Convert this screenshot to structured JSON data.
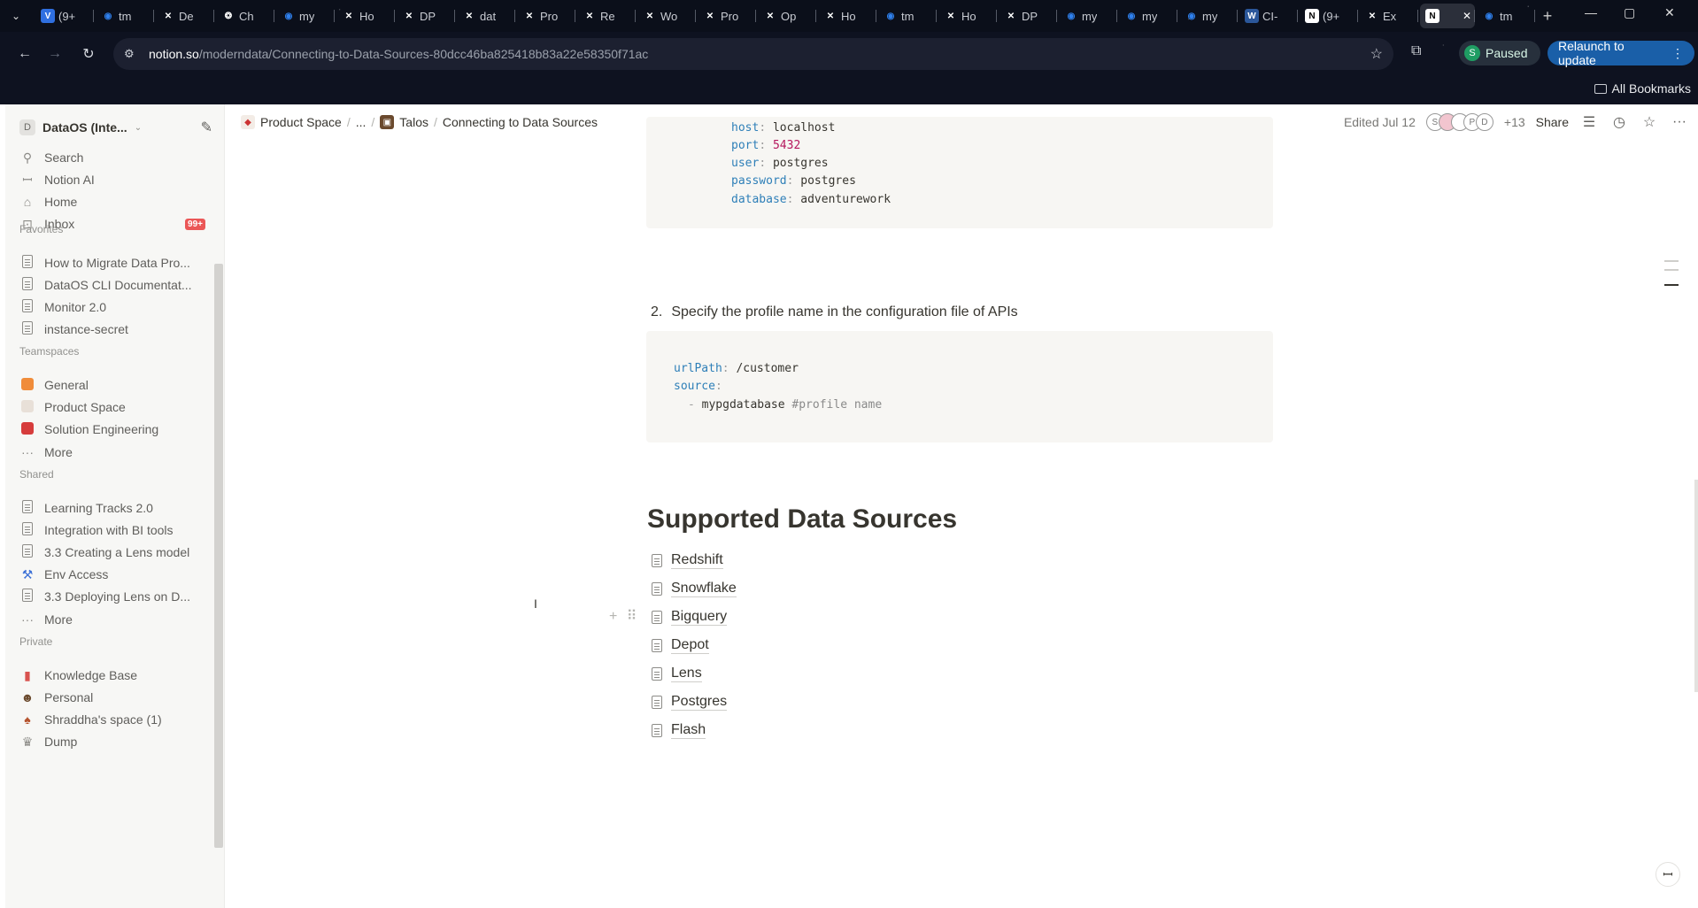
{
  "browser": {
    "tabs": [
      {
        "label": "(9+",
        "icon": "V",
        "color": "#2f6fe0"
      },
      {
        "label": "tm",
        "icon": "cloud",
        "color": "#2f80ed"
      },
      {
        "label": "De",
        "icon": "confluence",
        "color": "#ffffff"
      },
      {
        "label": "Ch",
        "icon": "chatgpt",
        "color": "#ffffff"
      },
      {
        "label": "my",
        "icon": "cloud",
        "color": "#2f80ed"
      },
      {
        "label": "Ho",
        "icon": "confluence",
        "color": "#ffffff"
      },
      {
        "label": "DP",
        "icon": "confluence",
        "color": "#ffffff"
      },
      {
        "label": "dat",
        "icon": "confluence",
        "color": "#ffffff"
      },
      {
        "label": "Pro",
        "icon": "confluence",
        "color": "#ffffff"
      },
      {
        "label": "Re",
        "icon": "confluence",
        "color": "#ffffff"
      },
      {
        "label": "Wo",
        "icon": "confluence",
        "color": "#ffffff"
      },
      {
        "label": "Pro",
        "icon": "confluence",
        "color": "#ffffff"
      },
      {
        "label": "Op",
        "icon": "confluence",
        "color": "#ffffff"
      },
      {
        "label": "Ho",
        "icon": "confluence",
        "color": "#ffffff"
      },
      {
        "label": "tm",
        "icon": "cloud",
        "color": "#2f80ed"
      },
      {
        "label": "Ho",
        "icon": "confluence",
        "color": "#ffffff"
      },
      {
        "label": "DP",
        "icon": "confluence",
        "color": "#ffffff"
      },
      {
        "label": "my",
        "icon": "cloud",
        "color": "#2f80ed"
      },
      {
        "label": "my",
        "icon": "cloud",
        "color": "#2f80ed"
      },
      {
        "label": "my",
        "icon": "cloud",
        "color": "#2f80ed"
      },
      {
        "label": "CI-",
        "icon": "word",
        "color": "#2b579a"
      },
      {
        "label": "(9+",
        "icon": "notion",
        "color": "#ffffff"
      },
      {
        "label": "Ex",
        "icon": "confluence",
        "color": "#ffffff"
      },
      {
        "label": "",
        "icon": "notion",
        "color": "#ffffff",
        "active": true
      },
      {
        "label": "tm",
        "icon": "cloud",
        "color": "#2f80ed"
      }
    ],
    "url_host": "notion.so",
    "url_path": "/moderndata/Connecting-to-Data-Sources-80dcc46ba825418b83a22e58350f71ac",
    "profile_initial": "S",
    "profile_status": "Paused",
    "relaunch_label": "Relaunch to update",
    "bookmarks_label": "All Bookmarks"
  },
  "sidebar": {
    "workspace_initial": "D",
    "workspace_name": "DataOS (Inte...",
    "top_items": [
      {
        "label": "Search",
        "icon": "search-icon"
      },
      {
        "label": "Notion AI",
        "icon": "notion-ai-icon"
      },
      {
        "label": "Home",
        "icon": "home-icon"
      },
      {
        "label": "Inbox",
        "icon": "inbox-icon",
        "badge": "99+"
      }
    ],
    "favorites_title": "Favorites",
    "favorites": [
      "How to Migrate Data Pro...",
      "DataOS CLI Documentat...",
      "Monitor 2.0",
      "instance-secret"
    ],
    "teamspaces_title": "Teamspaces",
    "teamspaces": [
      {
        "label": "General",
        "color": "#f08c3a"
      },
      {
        "label": "Product Space",
        "color": "#e8e0d8"
      },
      {
        "label": "Solution Engineering",
        "color": "#d63c3c"
      }
    ],
    "teamspaces_more": "More",
    "shared_title": "Shared",
    "shared": [
      {
        "label": "Learning Tracks 2.0",
        "icon": "page"
      },
      {
        "label": "Integration with BI tools",
        "icon": "page"
      },
      {
        "label": "3.3 Creating a Lens model",
        "icon": "page"
      },
      {
        "label": "Env Access",
        "icon": "hammer"
      },
      {
        "label": "3.3 Deploying Lens on D...",
        "icon": "page"
      }
    ],
    "shared_more": "More",
    "private_title": "Private",
    "private": [
      {
        "label": "Knowledge Base",
        "icon": "book"
      },
      {
        "label": "Personal",
        "icon": "face"
      },
      {
        "label": "Shraddha's space (1)",
        "icon": "mushroom"
      },
      {
        "label": "Dump",
        "icon": "trophy"
      }
    ]
  },
  "topbar": {
    "breadcrumbs": [
      "Product Space",
      "...",
      "Talos",
      "Connecting to Data Sources"
    ],
    "edited": "Edited Jul 12",
    "faces": [
      "S",
      "",
      "",
      "P",
      "D"
    ],
    "more_count": "+13",
    "share_label": "Share"
  },
  "content": {
    "code1": {
      "host_key": "host",
      "host_val": "localhost",
      "port_key": "port",
      "port_val": "5432",
      "user_key": "user",
      "user_val": "postgres",
      "password_key": "password",
      "password_val": "postgres",
      "database_key": "database",
      "database_val": "adventurework"
    },
    "step_number": "2.",
    "step_text": "Specify the profile name in the configuration file of APIs",
    "code2": {
      "urlpath_key": "urlPath",
      "urlpath_val": "/customer",
      "source_key": "source",
      "item_val": "mypgdatabase",
      "comment": "#profile name"
    },
    "heading": "Supported Data Sources",
    "sources": [
      "Redshift",
      "Snowflake",
      "Bigquery",
      "Depot",
      "Lens",
      "Postgres",
      "Flash"
    ]
  }
}
